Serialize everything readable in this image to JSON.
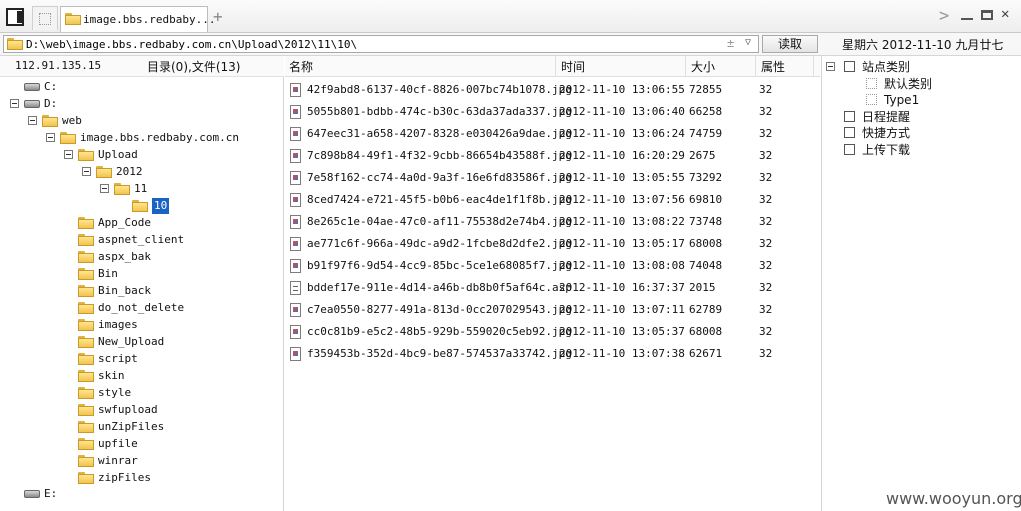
{
  "tab": {
    "title": "image.bbs.redbaby..."
  },
  "address": {
    "path": "D:\\web\\image.bbs.redbaby.com.cn\\Upload\\2012\\11\\10\\",
    "read_button": "读取",
    "date": "星期六 2012-11-10 九月廿七"
  },
  "left": {
    "ip": "112.91.135.15",
    "summary": "目录(0),文件(13)",
    "tree": [
      {
        "label": "C:",
        "type": "drive",
        "level": 0,
        "expanded": false
      },
      {
        "label": "D:",
        "type": "drive",
        "level": 0,
        "expanded": true
      },
      {
        "label": "web",
        "type": "folder",
        "level": 1,
        "expanded": true
      },
      {
        "label": "image.bbs.redbaby.com.cn",
        "type": "folder",
        "level": 2,
        "expanded": true
      },
      {
        "label": "Upload",
        "type": "folder",
        "level": 3,
        "expanded": true
      },
      {
        "label": "2012",
        "type": "folder",
        "level": 4,
        "expanded": true
      },
      {
        "label": "11",
        "type": "folder",
        "level": 5,
        "expanded": true
      },
      {
        "label": "10",
        "type": "folder",
        "level": 6,
        "expanded": false,
        "selected": true
      },
      {
        "label": "App_Code",
        "type": "folder",
        "level": 3
      },
      {
        "label": "aspnet_client",
        "type": "folder",
        "level": 3
      },
      {
        "label": "aspx_bak",
        "type": "folder",
        "level": 3
      },
      {
        "label": "Bin",
        "type": "folder",
        "level": 3
      },
      {
        "label": "Bin_back",
        "type": "folder",
        "level": 3
      },
      {
        "label": "do_not_delete",
        "type": "folder",
        "level": 3
      },
      {
        "label": "images",
        "type": "folder",
        "level": 3
      },
      {
        "label": "New_Upload",
        "type": "folder",
        "level": 3
      },
      {
        "label": "script",
        "type": "folder",
        "level": 3
      },
      {
        "label": "skin",
        "type": "folder",
        "level": 3
      },
      {
        "label": "style",
        "type": "folder",
        "level": 3
      },
      {
        "label": "swfupload",
        "type": "folder",
        "level": 3
      },
      {
        "label": "unZipFiles",
        "type": "folder",
        "level": 3
      },
      {
        "label": "upfile",
        "type": "folder",
        "level": 3
      },
      {
        "label": "winrar",
        "type": "folder",
        "level": 3
      },
      {
        "label": "zipFiles",
        "type": "folder",
        "level": 3
      },
      {
        "label": "E:",
        "type": "drive",
        "level": 0,
        "expanded": false
      }
    ]
  },
  "files": {
    "headers": {
      "name": "名称",
      "time": "时间",
      "size": "大小",
      "attr": "属性"
    },
    "rows": [
      {
        "name": "42f9abd8-6137-40cf-8826-007bc74b1078.jpg",
        "time": "2012-11-10 13:06:55",
        "size": "72855",
        "attr": "32",
        "kind": "image"
      },
      {
        "name": "5055b801-bdbb-474c-b30c-63da37ada337.jpg",
        "time": "2012-11-10 13:06:40",
        "size": "66258",
        "attr": "32",
        "kind": "image"
      },
      {
        "name": "647eec31-a658-4207-8328-e030426a9dae.jpg",
        "time": "2012-11-10 13:06:24",
        "size": "74759",
        "attr": "32",
        "kind": "image"
      },
      {
        "name": "7c898b84-49f1-4f32-9cbb-86654b43588f.jpg",
        "time": "2012-11-10 16:20:29",
        "size": "2675",
        "attr": "32",
        "kind": "image"
      },
      {
        "name": "7e58f162-cc74-4a0d-9a3f-16e6fd83586f.jpg",
        "time": "2012-11-10 13:05:55",
        "size": "73292",
        "attr": "32",
        "kind": "image"
      },
      {
        "name": "8ced7424-e721-45f5-b0b6-eac4de1f1f8b.jpg",
        "time": "2012-11-10 13:07:56",
        "size": "69810",
        "attr": "32",
        "kind": "image"
      },
      {
        "name": "8e265c1e-04ae-47c0-af11-75538d2e74b4.jpg",
        "time": "2012-11-10 13:08:22",
        "size": "73748",
        "attr": "32",
        "kind": "image"
      },
      {
        "name": "ae771c6f-966a-49dc-a9d2-1fcbe8d2dfe2.jpg",
        "time": "2012-11-10 13:05:17",
        "size": "68008",
        "attr": "32",
        "kind": "image"
      },
      {
        "name": "b91f97f6-9d54-4cc9-85bc-5ce1e68085f7.jpg",
        "time": "2012-11-10 13:08:08",
        "size": "74048",
        "attr": "32",
        "kind": "image"
      },
      {
        "name": "bddef17e-911e-4d14-a46b-db8b0f5af64c.asp",
        "time": "2012-11-10 16:37:37",
        "size": "2015",
        "attr": "32",
        "kind": "doc"
      },
      {
        "name": "c7ea0550-8277-491a-813d-0cc207029543.jpg",
        "time": "2012-11-10 13:07:11",
        "size": "62789",
        "attr": "32",
        "kind": "image"
      },
      {
        "name": "cc0c81b9-e5c2-48b5-929b-559020c5eb92.jpg",
        "time": "2012-11-10 13:05:37",
        "size": "68008",
        "attr": "32",
        "kind": "image"
      },
      {
        "name": "f359453b-352d-4bc9-be87-574537a33742.jpg",
        "time": "2012-11-10 13:07:38",
        "size": "62671",
        "attr": "32",
        "kind": "image"
      }
    ]
  },
  "right": {
    "items": [
      {
        "label": "站点类别",
        "icon": "category-icon",
        "level": 0,
        "toggle": true
      },
      {
        "label": "默认类别",
        "icon": "subcategory-icon",
        "level": 1
      },
      {
        "label": "Type1",
        "icon": "subcategory-icon",
        "level": 1
      },
      {
        "label": "日程提醒",
        "icon": "schedule-icon",
        "level": 0
      },
      {
        "label": "快捷方式",
        "icon": "shortcut-icon",
        "level": 0
      },
      {
        "label": "上传下载",
        "icon": "transfer-icon",
        "level": 0
      }
    ]
  },
  "watermark": "www.wooyun.org"
}
